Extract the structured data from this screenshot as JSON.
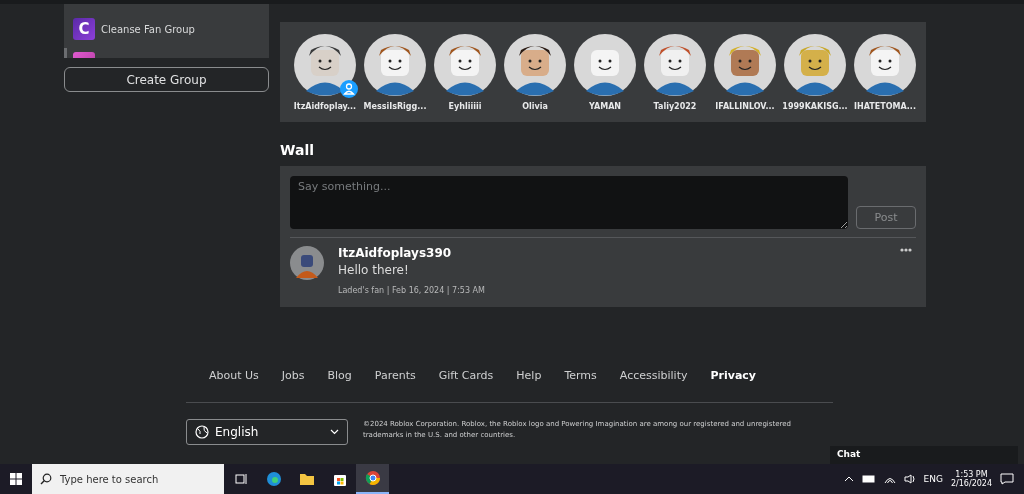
{
  "sidebar": {
    "groups": [
      {
        "kind": "full",
        "name": "Cleanse Fan Group",
        "logo_letter": "C",
        "selected": false
      },
      {
        "kind": "partial",
        "selected": true
      }
    ],
    "create_button": "Create Group"
  },
  "members": [
    {
      "name": "ItzAidfoplay...",
      "friend": true
    },
    {
      "name": "MessiIsRigg...",
      "friend": false
    },
    {
      "name": "Eyhliiiii",
      "friend": false
    },
    {
      "name": "Olivia",
      "friend": false
    },
    {
      "name": "YAMAN",
      "friend": false
    },
    {
      "name": "Taliy2022",
      "friend": false
    },
    {
      "name": "IFALLINLOV...",
      "friend": false
    },
    {
      "name": "1999KAKISG...",
      "friend": false
    },
    {
      "name": "IHATETOMA...",
      "friend": false
    }
  ],
  "wall": {
    "title": "Wall",
    "placeholder": "Say something...",
    "post_button": {
      "label": "Post",
      "disabled": true
    },
    "posts": [
      {
        "author": "ItzAidfoplays390",
        "text": "Hello there!",
        "meta": "Laded's fan | Feb 16, 2024 | 7:53 AM"
      }
    ]
  },
  "footer": {
    "links": [
      {
        "label": "About Us",
        "emphasized": false
      },
      {
        "label": "Jobs",
        "emphasized": false
      },
      {
        "label": "Blog",
        "emphasized": false
      },
      {
        "label": "Parents",
        "emphasized": false
      },
      {
        "label": "Gift Cards",
        "emphasized": false
      },
      {
        "label": "Help",
        "emphasized": false
      },
      {
        "label": "Terms",
        "emphasized": false
      },
      {
        "label": "Accessibility",
        "emphasized": false
      },
      {
        "label": "Privacy",
        "emphasized": true
      }
    ],
    "language": "English",
    "copyright": "©2024 Roblox Corporation. Roblox, the Roblox logo and Powering Imagination are among our registered and unregistered trademarks in the U.S. and other countries."
  },
  "chat": {
    "title": "Chat"
  },
  "taskbar": {
    "search_placeholder": "Type here to search",
    "language": "ENG",
    "time": "1:53 PM",
    "date": "2/16/2024"
  }
}
